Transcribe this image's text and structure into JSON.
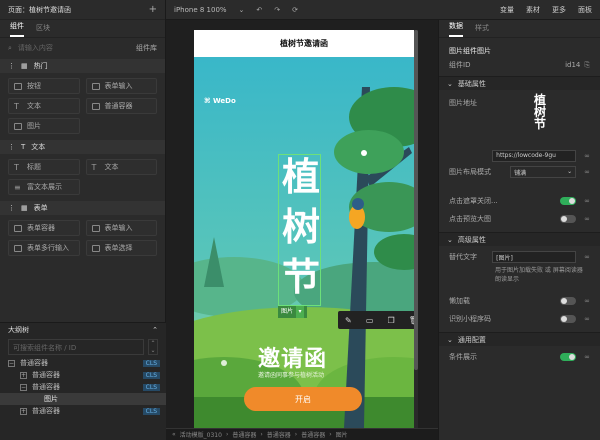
{
  "left_panel": {
    "header": "页面：植树节邀请函",
    "tabs": [
      "组件",
      "区块"
    ],
    "search_placeholder": "请输入内容",
    "library_label": "组件库",
    "sections": [
      {
        "title": "热门",
        "items": [
          {
            "label": "按钮",
            "icon": "rect-icon"
          },
          {
            "label": "表单输入",
            "icon": "rect-icon"
          },
          {
            "label": "文本",
            "icon": "text-icon"
          },
          {
            "label": "普通容器",
            "icon": "rect-icon"
          },
          {
            "label": "图片",
            "icon": "image-icon"
          }
        ]
      },
      {
        "title": "文本",
        "items": [
          {
            "label": "标题",
            "icon": "text-icon"
          },
          {
            "label": "文本",
            "icon": "text-icon"
          },
          {
            "label": "富文本展示",
            "icon": "list-icon"
          }
        ]
      },
      {
        "title": "表单",
        "items": [
          {
            "label": "表单容器",
            "icon": "rect-icon"
          },
          {
            "label": "表单输入",
            "icon": "rect-icon"
          },
          {
            "label": "表单多行输入",
            "icon": "rect-icon"
          },
          {
            "label": "表单选择",
            "icon": "rect-icon"
          }
        ]
      }
    ],
    "outline": {
      "title": "大纲树",
      "search_placeholder": "可搜索组件名称 / ID",
      "rows": [
        {
          "name": "普通容器",
          "indent": 0,
          "toggle": "−",
          "cls": "CLS"
        },
        {
          "name": "普通容器",
          "indent": 1,
          "toggle": "+",
          "cls": "CLS"
        },
        {
          "name": "普通容器",
          "indent": 1,
          "toggle": "−",
          "cls": "CLS"
        },
        {
          "name": "图片",
          "indent": 2,
          "toggle": "",
          "cls": "",
          "selected": true
        },
        {
          "name": "普通容器",
          "indent": 1,
          "toggle": "+",
          "cls": "CLS"
        }
      ]
    }
  },
  "topbar": {
    "device": "iPhone 8  100%",
    "right_items": [
      "变量",
      "素材",
      "更多",
      "面板"
    ]
  },
  "canvas": {
    "page_title": "植树节邀请函",
    "brand": "WeDo",
    "big_chars": [
      "植",
      "树",
      "节"
    ],
    "selected_tag": "图片",
    "invite_title": "邀请函",
    "invite_sub": "邀请函同事参与植树活动",
    "start_button": "开启",
    "colors": {
      "sky": "#3ab8c8",
      "grass": "#7cc04a",
      "accent": "#f08a2a",
      "select": "#6de07a"
    }
  },
  "breadcrumb": [
    "活动模版_0310",
    "普通容器",
    "普通容器",
    "普通容器",
    "图片"
  ],
  "right_panel": {
    "tabs": [
      "数据",
      "样式"
    ],
    "component_title": "图片组件图片",
    "component_id_label": "组件ID",
    "component_id": "id14",
    "group_basic": "基础属性",
    "image_src_label": "图片地址",
    "preview_chars": [
      "植",
      "树",
      "节"
    ],
    "url_value": "https://lowcode-9gu",
    "fit_label": "图片布局模式",
    "fit_value": "铺满",
    "mask_close_label": "点击遮罩关闭...",
    "preview_big_label": "点击预览大图",
    "group_advanced": "高级属性",
    "alt_label": "替代文字",
    "alt_value": "[图片]",
    "alt_desc": "用于图片加载失败 或 屏幕阅读器朗读显示",
    "lazy_label": "懒加载",
    "qr_label": "识别小程序码",
    "group_common": "通用配置",
    "cond_label": "条件展示"
  }
}
